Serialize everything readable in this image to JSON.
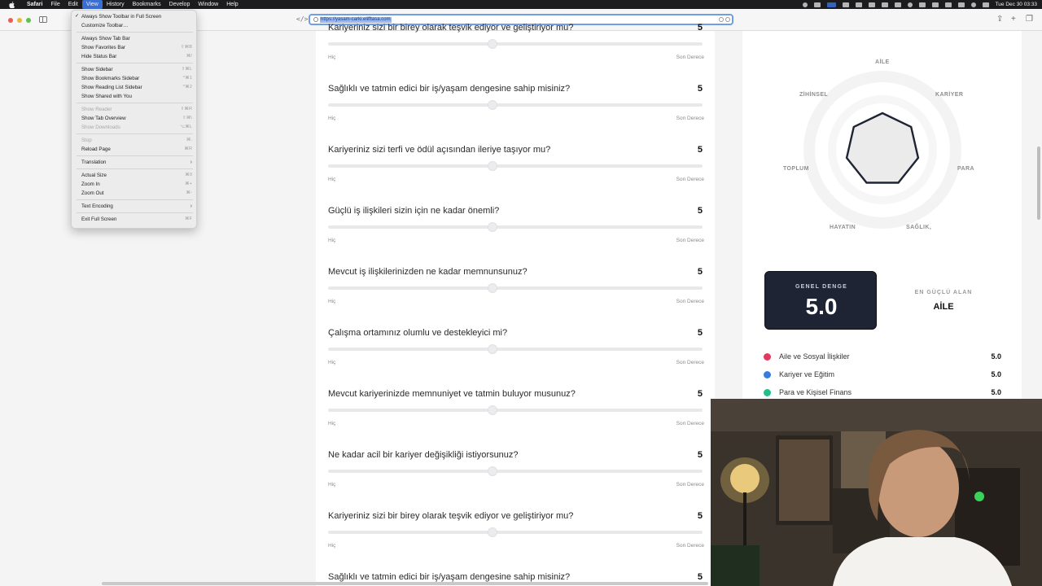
{
  "menubar": {
    "app": "Safari",
    "items": [
      "File",
      "Edit",
      "View",
      "History",
      "Bookmarks",
      "Develop",
      "Window",
      "Help"
    ],
    "active": "View",
    "clock": "Tue Dec 30  03:33"
  },
  "toolbar": {
    "url": "https://yasam-carki.elifftasa.com"
  },
  "view_menu": {
    "items": [
      {
        "label": "Always Show Toolbar in Full Screen",
        "checked": true,
        "shortcut": ""
      },
      {
        "label": "Customize Toolbar…",
        "shortcut": ""
      },
      {
        "label": "Always Show Tab Bar",
        "shortcut": ""
      },
      {
        "label": "Show Favorites Bar",
        "shortcut": "⇧⌘B"
      },
      {
        "label": "Hide Status Bar",
        "shortcut": "⌘/"
      },
      {
        "label": "Show Sidebar",
        "shortcut": "⇧⌘L"
      },
      {
        "label": "Show Bookmarks Sidebar",
        "shortcut": "^⌘1"
      },
      {
        "label": "Show Reading List Sidebar",
        "shortcut": "^⌘2"
      },
      {
        "label": "Show Shared with You",
        "shortcut": ""
      },
      {
        "label": "Show Reader",
        "shortcut": "⇧⌘R",
        "disabled": true
      },
      {
        "label": "Show Tab Overview",
        "shortcut": "⇧⌘\\"
      },
      {
        "label": "Show Downloads",
        "shortcut": "⌥⌘L",
        "disabled": true
      },
      {
        "label": "Stop",
        "shortcut": "⌘.",
        "disabled": true
      },
      {
        "label": "Reload Page",
        "shortcut": "⌘R"
      },
      {
        "label": "Translation",
        "submenu": true
      },
      {
        "label": "Actual Size",
        "shortcut": "⌘0"
      },
      {
        "label": "Zoom In",
        "shortcut": "⌘+"
      },
      {
        "label": "Zoom Out",
        "shortcut": "⌘-"
      },
      {
        "label": "Text Encoding",
        "submenu": true
      },
      {
        "label": "Exit Full Screen",
        "shortcut": "⌘F"
      }
    ]
  },
  "questions": [
    {
      "text": "Kariyeriniz sizi bir birey olarak teşvik ediyor ve geliştiriyor mu?",
      "value": "5"
    },
    {
      "text": "Sağlıklı ve tatmin edici bir iş/yaşam dengesine sahip misiniz?",
      "value": "5"
    },
    {
      "text": "Kariyeriniz sizi terfi ve ödül açısından ileriye taşıyor mu?",
      "value": "5"
    },
    {
      "text": "Güçlü iş ilişkileri sizin için ne kadar önemli?",
      "value": "5"
    },
    {
      "text": "Mevcut iş ilişkilerinizden ne kadar memnunsunuz?",
      "value": "5"
    },
    {
      "text": "Çalışma ortamınız olumlu ve destekleyici mi?",
      "value": "5"
    },
    {
      "text": "Mevcut kariyerinizde memnuniyet ve tatmin buluyor musunuz?",
      "value": "5"
    },
    {
      "text": "Ne kadar acil bir kariyer değişikliği istiyorsunuz?",
      "value": "5"
    },
    {
      "text": "Kariyeriniz sizi bir birey olarak teşvik ediyor ve geliştiriyor mu?",
      "value": "5"
    },
    {
      "text": "Sağlıklı ve tatmin edici bir iş/yaşam dengesine sahip misiniz?",
      "value": "5"
    }
  ],
  "slider": {
    "low": "Hiç",
    "high": "Son Derece",
    "level_fraction": 0.44
  },
  "radar": {
    "labels": [
      "AİLE",
      "KARİYER",
      "PARA",
      "SAĞLIK,",
      "HAYATIN",
      "TOPLUM",
      "ZİHİNSEL"
    ]
  },
  "summary": {
    "genel_denge_label": "GENEL DENGE",
    "genel_denge_value": "5.0",
    "strongest_label": "EN GÜÇLÜ ALAN",
    "strongest_value": "AİLE"
  },
  "legend": [
    {
      "name": "Aile ve Sosyal İlişkiler",
      "value": "5.0",
      "color": "#e23a5e"
    },
    {
      "name": "Kariyer ve Eğitim",
      "value": "5.0",
      "color": "#3b7be0"
    },
    {
      "name": "Para ve Kişisel Finans",
      "value": "5.0",
      "color": "#20c08a"
    }
  ]
}
